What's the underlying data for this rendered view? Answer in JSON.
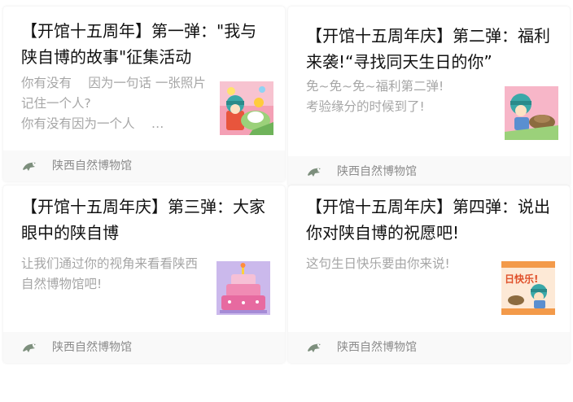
{
  "articles": [
    {
      "title": "【开馆十五周年】第一弹：\"我与陕自博的故事\"征集活动",
      "description": "你有没有　 因为一句话 一张照片　 记住一个人?\n你有没有因为一个人　 …",
      "thumbnail_icon": "cartoon-celebration-thumbnail",
      "source": "陕西自然博物馆",
      "source_icon": "museum-logo-icon"
    },
    {
      "title": "【开馆十五周年庆】第二弹：福利来袭!“寻找同天生日的你”",
      "description": "免~免~免~福利第二弹!\n考验缘分的时候到了!",
      "thumbnail_icon": "cartoon-pink-thumbnail",
      "source": "陕西自然博物馆",
      "source_icon": "museum-logo-icon"
    },
    {
      "title": "【开馆十五周年庆】第三弹：大家眼中的陕自博",
      "description": "让我们通过你的视角来看看陕西自然博物馆吧!",
      "thumbnail_icon": "birthday-cake-thumbnail",
      "source": "陕西自然博物馆",
      "source_icon": "museum-logo-icon"
    },
    {
      "title": "【开馆十五周年庆】第四弹：说出你对陕自博的祝愿吧!",
      "description": "这句生日快乐要由你来说!",
      "thumbnail_icon": "birthday-greeting-thumbnail",
      "thumbnail_text": "日快乐!",
      "source": "陕西自然博物馆",
      "source_icon": "museum-logo-icon"
    }
  ],
  "colors": {
    "title": "#111111",
    "description": "#a6a6a6",
    "source": "#8c8c8c",
    "footer_bg": "#f9f9f9",
    "logo": "#7d8f7d"
  }
}
